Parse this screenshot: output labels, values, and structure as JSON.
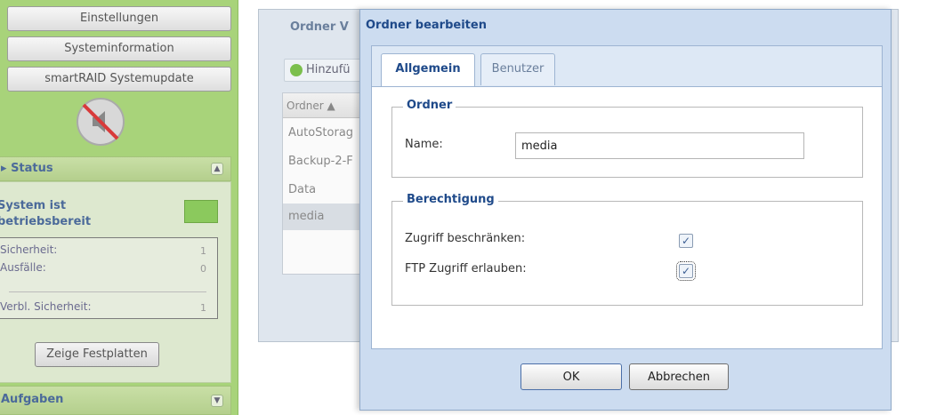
{
  "left_panel": {
    "nav_buttons": [
      "Einstellungen",
      "Systeminformation",
      "smartRAID Systemupdate"
    ],
    "status": {
      "title": "Status",
      "system_ready": "System ist betriebsbereit",
      "security": [
        {
          "label": "Sicherheit:",
          "value": "1"
        },
        {
          "label": "Ausfälle:",
          "value": "0"
        },
        {
          "label": "Verbl. Sicherheit:",
          "value": "1"
        }
      ],
      "show_disks": "Zeige Festplatten"
    },
    "tasks_title": "Aufgaben",
    "colors": {
      "background": "#a8d37a",
      "status_ok": "#8bc95d"
    }
  },
  "folder_window": {
    "title": "Ordner V",
    "add_button": "Hinzufü",
    "column_header": "Ordner",
    "rows": [
      "AutoStorag",
      "Backup-2-F",
      "Data",
      "media"
    ],
    "selected": "media"
  },
  "dialog": {
    "title": "Ordner bearbeiten",
    "tabs": [
      {
        "label": "Allgemein",
        "active": true
      },
      {
        "label": "Benutzer",
        "active": false
      }
    ],
    "folder_section": {
      "legend": "Ordner",
      "name_label": "Name:",
      "name_value": "media"
    },
    "permission_section": {
      "legend": "Berechtigung",
      "restrict_label": "Zugriff beschränken:",
      "restrict_checked": true,
      "ftp_label": "FTP Zugriff erlauben:",
      "ftp_checked": true
    },
    "ok_label": "OK",
    "cancel_label": "Abbrechen"
  }
}
